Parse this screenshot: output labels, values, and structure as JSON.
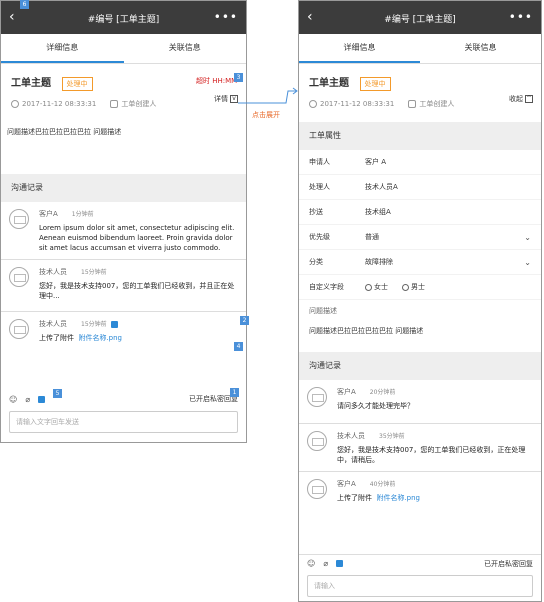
{
  "ticket": {
    "title": "#编号  [工单主题]",
    "subject": "工单主题",
    "status": "处理中",
    "date": "2017-11-12  08:33:31",
    "creator": "工单创建人",
    "detail_label": "详情",
    "collapse_label": "收起",
    "description": "问题描述巴拉巴拉巴拉巴拉 问题描述"
  },
  "tabs": [
    "详细信息",
    "关联信息"
  ],
  "annotations": {
    "timeout": "超时 HH:MM",
    "expand_hint": "点击展开",
    "m1": "1",
    "m2": "2",
    "m3": "3",
    "m4": "4",
    "m5": "5",
    "m6": "6"
  },
  "left": {
    "comm_title": "沟通记录",
    "messages": [
      {
        "name": "客户A",
        "time": "1分钟前",
        "text": "Lorem ipsum dolor sit amet, consectetur adipiscing elit. Aenean euismod bibendum laoreet. Proin gravida dolor sit amet lacus accumsan et viverra justo commodo."
      },
      {
        "name": "技术人员",
        "time": "15分钟前",
        "text": "您好，我是技术支持007，您的工单我们已经收到，并且正在处理中..."
      },
      {
        "name": "技术人员",
        "time": "15分钟前",
        "text_prefix": "上传了附件",
        "attachment": "附件名称.png"
      }
    ],
    "private_toggle": "已开启私密回复",
    "input_placeholder": "请输入文字回车发送"
  },
  "right": {
    "props_title": "工单属性",
    "props": [
      {
        "label": "申请人",
        "value": "客户 A"
      },
      {
        "label": "处理人",
        "value": "技术人员A"
      },
      {
        "label": "抄送",
        "value": "技术组A"
      },
      {
        "label": "优先级",
        "value": "普通"
      },
      {
        "label": "分类",
        "value": "故障排除"
      }
    ],
    "custom_label": "自定义字段",
    "radio_female": "女士",
    "radio_male": "男士",
    "desc_label": "问题描述",
    "description": "问题描述巴拉巴拉巴拉巴拉 问题描述",
    "comm_title": "沟通记录",
    "messages": [
      {
        "name": "客户A",
        "time": "20分钟前",
        "text": "请问多久才能处理完毕？"
      },
      {
        "name": "技术人员",
        "time": "35分钟前",
        "text": "您好，我是技术支持007，您的工单我们已经收到，正在处理中，请稍后。"
      },
      {
        "name": "客户A",
        "time": "40分钟前",
        "text_prefix": "上传了附件",
        "attachment": "附件名称.png"
      }
    ],
    "private_toggle": "已开启私密回复",
    "input_placeholder": "请输入"
  },
  "colors": {
    "accent": "#2c89d6",
    "status": "#f39a2b",
    "titlebar": "#3c3c3c"
  }
}
